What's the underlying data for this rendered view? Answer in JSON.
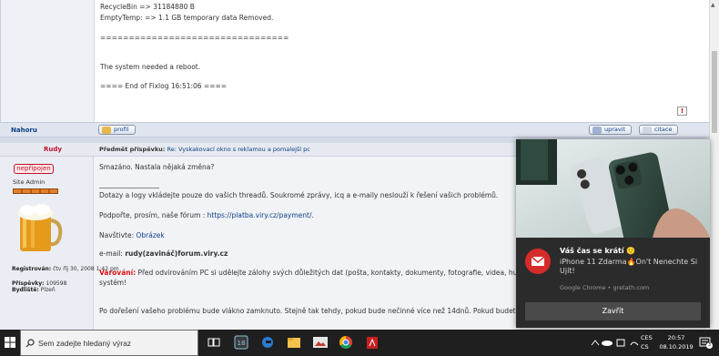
{
  "log_post": {
    "lines": [
      "RecycleBin => 31184880 B",
      "EmptyTemp: => 1.1 GB temporary data Removed.",
      "=================================",
      "The system needed a reboot.",
      "==== End of Fixlog 16:51:06 ===="
    ]
  },
  "nav_bar": {
    "top_link": "Nahoru",
    "profile_button": "profil",
    "edit_button": "upravit",
    "quote_button": "citace"
  },
  "post": {
    "author": "Rudy",
    "subject_label": "Předmět příspěvku:",
    "subject_re": "Re:",
    "subject_text": "Vyskakovací okno s reklamou a pomalejší pc",
    "status_badge": "nepřipojen",
    "rank": "Site Admin",
    "registered_label": "Registrován:",
    "registered_value": "čtv říj 30, 2008 1:42 pm",
    "posts_label": "Příspěvky:",
    "posts_value": "109598",
    "location_label": "Bydliště:",
    "location_value": "Plzeň",
    "body": {
      "line1": "Smazáno. Nastala nějaká změna?",
      "line2": "Dotazy a logy vkládejte pouze do vašich threadů. Soukromé zprávy, icq a e-maily neslouží k řešení vašich problémů.",
      "line3_prefix": "Podpořte, prosím, naše fórum : ",
      "line3_link": "https://platba.viry.cz/payment/",
      "line3_suffix": ".",
      "line4_prefix": "Navštivte: ",
      "line4_link": "Obrázek",
      "line5_prefix": "e-mail: ",
      "line5_value": "rudy(zavináč)forum.viry.cz",
      "line6_warn": "Varování:",
      "line6_text": " Před odvirováním PC si udělejte zálohy svých důležitých dat (pošta, kontakty, dokumenty, fotografie, videa, hudba apod.).",
      "line6b": "systém!",
      "line7": "Po dořešení vašeho problému bude vlákno zamknuto. Stejně tak tehdy, pokud bude nečinné více než 14dnů. Pokud budete chtít vlákno"
    }
  },
  "notification": {
    "title": "Váš čas se krátí 🙂",
    "message": "iPhone 11 Zdarma🔥On't Nenechte Si Ujít!",
    "source": "Google Chrome • gretath.com",
    "close_button": "Zavřít"
  },
  "taskbar": {
    "search_placeholder": "Sem zadejte hledaný výraz",
    "language_line1": "CES",
    "language_line2": "CS",
    "time": "20:57",
    "date": "08.10.2019",
    "notification_count": "3"
  },
  "colors": {
    "author_red": "#c0142c",
    "link_blue": "#0b3f86",
    "warning_red": "#dd1111",
    "toast_bg": "#2b2b2b",
    "taskbar_bg": "#1f1f1f"
  }
}
